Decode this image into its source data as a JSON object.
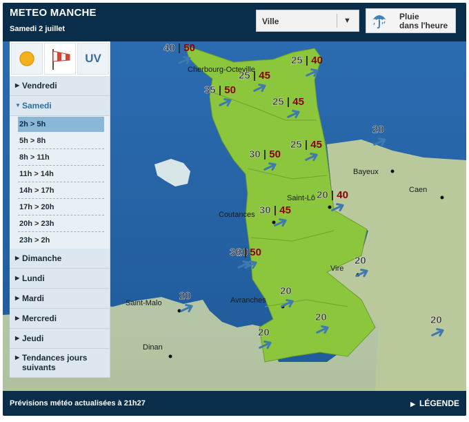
{
  "header": {
    "title": "METEO MANCHE",
    "date": "Samedi 2 juillet"
  },
  "ville_select": {
    "value": "Ville"
  },
  "rain_button": {
    "line1": "Pluie",
    "line2": "dans l'heure"
  },
  "tabs": [
    {
      "name": "sun-icon"
    },
    {
      "name": "windsock-icon"
    },
    {
      "name": "uv",
      "label": "UV"
    }
  ],
  "days": [
    {
      "label": "Vendredi"
    },
    {
      "label": "Samedi"
    },
    {
      "label": "Dimanche"
    },
    {
      "label": "Lundi"
    },
    {
      "label": "Mardi"
    },
    {
      "label": "Mercredi"
    },
    {
      "label": "Jeudi"
    },
    {
      "label_line1": "Tendances jours",
      "label_line2": "suivants"
    }
  ],
  "time_slots": [
    {
      "label": "2h > 5h"
    },
    {
      "label": "5h > 8h"
    },
    {
      "label": "8h > 11h"
    },
    {
      "label": "11h > 14h"
    },
    {
      "label": "14h > 17h"
    },
    {
      "label": "17h > 20h"
    },
    {
      "label": "20h > 23h"
    },
    {
      "label": "23h > 2h"
    }
  ],
  "cities": [
    {
      "name": "Cherbourg-Octeville"
    },
    {
      "name": "Bayeux"
    },
    {
      "name": "Caen"
    },
    {
      "name": "Saint-Lô"
    },
    {
      "name": "Coutances"
    },
    {
      "name": "Vire"
    },
    {
      "name": "Saint-Malo"
    },
    {
      "name": "Avranches"
    },
    {
      "name": "Dinan"
    }
  ],
  "wind": [
    {
      "speed": "40",
      "gust": "50"
    },
    {
      "speed": "25",
      "gust": "40"
    },
    {
      "speed": "25",
      "gust": "45"
    },
    {
      "speed": "35",
      "gust": "50"
    },
    {
      "speed": "25",
      "gust": "45"
    },
    {
      "speed": "20",
      "gust": ""
    },
    {
      "speed": "30",
      "gust": "50"
    },
    {
      "speed": "25",
      "gust": "45"
    },
    {
      "speed": "20",
      "gust": "40"
    },
    {
      "speed": "20",
      "gust": ""
    },
    {
      "speed": "30",
      "gust": "45"
    },
    {
      "speed": "30",
      "gust": "50"
    },
    {
      "speed": "20",
      "gust": ""
    },
    {
      "speed": "20",
      "gust": ""
    },
    {
      "speed": "20",
      "gust": ""
    },
    {
      "speed": "20",
      "gust": ""
    },
    {
      "speed": "20",
      "gust": ""
    },
    {
      "speed": "20",
      "gust": ""
    }
  ],
  "footer": {
    "update_text": "Prévisions météo actualisées à 21h27",
    "legend_label": "LÉGENDE"
  },
  "colors": {
    "header_bg": "#0a2d4a",
    "land": "#8fcf3c",
    "sea": "#2a64a8",
    "gust": "#8b0000",
    "arrow": "#3e79b0"
  }
}
